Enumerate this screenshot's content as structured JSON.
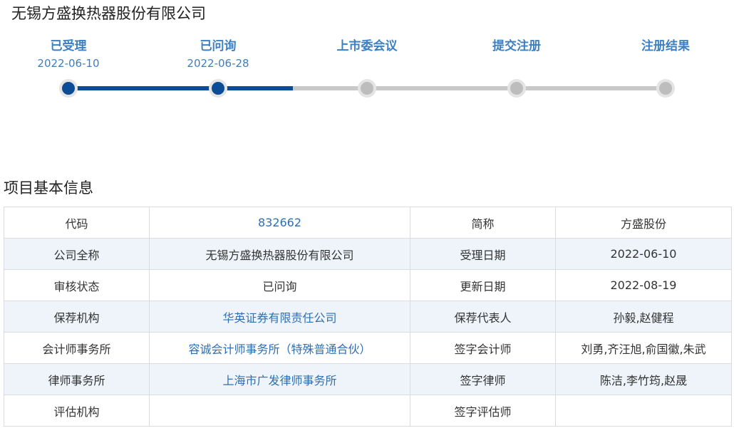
{
  "company_title": "无锡方盛换热器股份有限公司",
  "progress": {
    "steps": [
      {
        "label": "已受理",
        "date": "2022-06-10",
        "status": "done"
      },
      {
        "label": "已问询",
        "date": "2022-06-28",
        "status": "done"
      },
      {
        "label": "上市委会议",
        "date": "",
        "status": "pending"
      },
      {
        "label": "提交注册",
        "date": "",
        "status": "pending"
      },
      {
        "label": "注册结果",
        "date": "",
        "status": "pending"
      }
    ],
    "colors": {
      "done": "#0a4d96",
      "pending": "#bdbdbd",
      "label": "#3d7fc1"
    }
  },
  "section_title": "项目基本信息",
  "info_table": {
    "rows": [
      {
        "k1": "代码",
        "v1": "832662",
        "k2": "简称",
        "v2": "方盛股份"
      },
      {
        "k1": "公司全称",
        "v1": "无锡方盛换热器股份有限公司",
        "k2": "受理日期",
        "v2": "2022-06-10"
      },
      {
        "k1": "审核状态",
        "v1": "已问询",
        "k2": "更新日期",
        "v2": "2022-08-19"
      },
      {
        "k1": "保荐机构",
        "v1": "华英证券有限责任公司",
        "k2": "保荐代表人",
        "v2": "孙毅,赵健程"
      },
      {
        "k1": "会计师事务所",
        "v1": "容诚会计师事务所（特殊普通合伙）",
        "k2": "签字会计师",
        "v2": "刘勇,齐汪旭,俞国徽,朱武"
      },
      {
        "k1": "律师事务所",
        "v1": "上海市广发律师事务所",
        "k2": "签字律师",
        "v2": "陈洁,李竹筠,赵晟"
      },
      {
        "k1": "评估机构",
        "v1": "",
        "k2": "签字评估师",
        "v2": ""
      }
    ],
    "link_color": "#2f6fb0",
    "stripe_color": "#eef4fa"
  }
}
